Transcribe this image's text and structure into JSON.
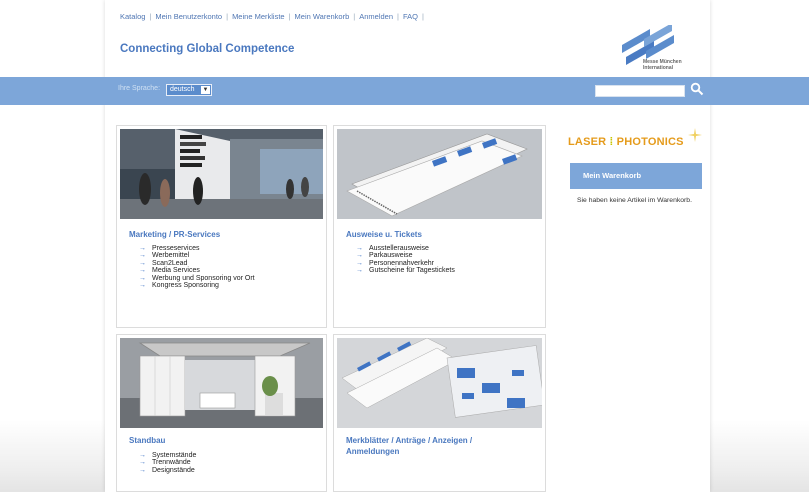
{
  "topnav": {
    "links": [
      "Katalog",
      "Mein Benutzerkonto",
      "Meine Merkliste",
      "Mein Warenkorb",
      "Anmelden",
      "FAQ"
    ]
  },
  "header": {
    "tagline": "Connecting Global Competence",
    "logo_text_1": "Messe München",
    "logo_text_2": "International"
  },
  "bar": {
    "language_label": "Ihre Sprache:",
    "language_value": "deutsch"
  },
  "cards": [
    {
      "title": "Marketing / PR-Services",
      "items": [
        "Presseservices",
        "Werbemittel",
        "Scan2Lead",
        "Media Services",
        "Werbung und Sponsoring vor Ort",
        "Kongress Sponsoring"
      ]
    },
    {
      "title": "Ausweise u. Tickets",
      "items": [
        "Ausstellerausweise",
        "Parkausweise",
        "Personennahverkehr",
        "Gutscheine für Tagestickets"
      ]
    },
    {
      "title": "Standbau",
      "items": [
        "Systemstände",
        "Trennwände",
        "Designstände"
      ]
    },
    {
      "title_line1": "Merkblätter / Anträge / Anzeigen /",
      "title_line2": "Anmeldungen"
    }
  ],
  "sidebar": {
    "brand_part1": "LASER",
    "brand_part2": "PHOTONICS",
    "cart_title": "Mein Warenkorb",
    "cart_empty": "Sie haben keine Artikel im Warenkorb."
  },
  "colors": {
    "accent_blue": "#4a78bf",
    "bar_blue": "#7da6d9",
    "brand_orange": "#e59b1b"
  }
}
